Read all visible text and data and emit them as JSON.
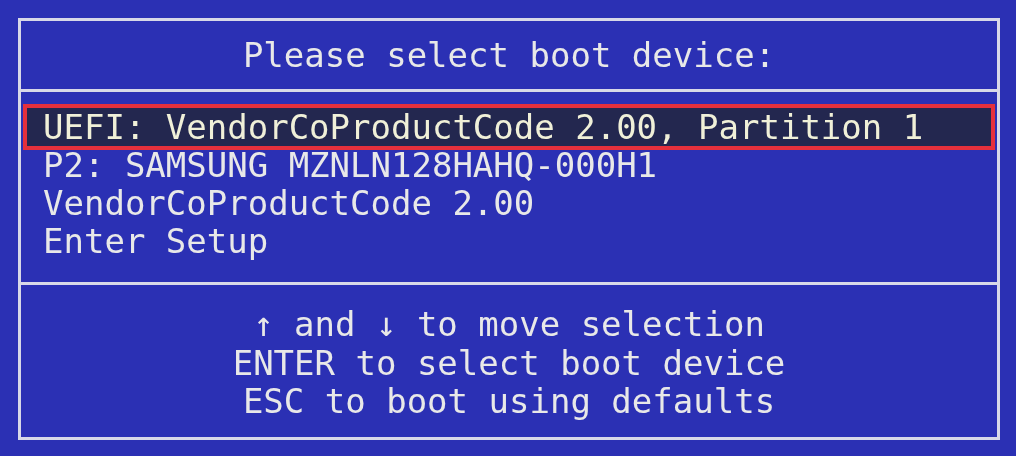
{
  "title": "Please select boot device:",
  "items": [
    {
      "label": "UEFI: VendorCoProductCode 2.00, Partition 1",
      "selected": true
    },
    {
      "label": "P2: SAMSUNG MZNLN128HAHQ-000H1",
      "selected": false
    },
    {
      "label": "VendorCoProductCode 2.00",
      "selected": false
    },
    {
      "label": "Enter Setup",
      "selected": false
    }
  ],
  "help": [
    "↑ and ↓ to move selection",
    "ENTER to select boot device",
    "ESC to boot using defaults"
  ]
}
